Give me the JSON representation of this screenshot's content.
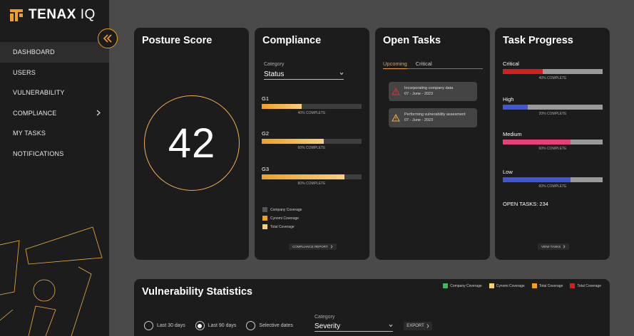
{
  "brand": {
    "name": "TENAX",
    "suffix": "IQ",
    "accent": "#f0a020"
  },
  "sidebar": {
    "items": [
      {
        "label": "DASHBOARD",
        "active": true
      },
      {
        "label": "USERS"
      },
      {
        "label": "VULNERABILITY"
      },
      {
        "label": "COMPLIANCE",
        "has_chevron": true
      },
      {
        "label": "MY TASKS"
      },
      {
        "label": "NOTIFICATIONS"
      }
    ]
  },
  "posture": {
    "title": "Posture Score",
    "score": "42"
  },
  "compliance": {
    "title": "Compliance",
    "category_label": "Category",
    "category_value": "Status",
    "groups": [
      {
        "name": "G1",
        "caption": "40% COMPLETE",
        "fraction": 0.4
      },
      {
        "name": "G2",
        "caption": "60% COMPLETE",
        "fraction": 0.62
      },
      {
        "name": "G3",
        "caption": "80% COMPLETE",
        "fraction": 0.83
      }
    ],
    "legend": [
      {
        "label": "Company Coverage",
        "color": "#555555"
      },
      {
        "label": "Cynomi Coverage",
        "color": "#f0a020"
      },
      {
        "label": "Total Coverage",
        "color": "#f5cf80"
      }
    ],
    "report_button": "COMPLIANCE REPORT"
  },
  "open_tasks": {
    "title": "Open Tasks",
    "tabs": [
      "Upcoming",
      "Critical"
    ],
    "items": [
      {
        "title": "Incorporating  company data",
        "date": "07 - June - 2023",
        "icon": "alert-triangle-red"
      },
      {
        "title": "Performing vulnerability assesment",
        "date": "07 - June - 2023",
        "icon": "alert-triangle-amber"
      }
    ]
  },
  "task_progress": {
    "title": "Task Progress",
    "groups": [
      {
        "name": "Critical",
        "caption": "40% COMPLETE",
        "fraction": 0.4,
        "color": "#d41f1f"
      },
      {
        "name": "High",
        "caption": "20% COMPLETE",
        "fraction": 0.25,
        "color": "#3f56d6"
      },
      {
        "name": "Medium",
        "caption": "60% COMPLETE",
        "fraction": 0.68,
        "color": "#e8407a"
      },
      {
        "name": "Low",
        "caption": "60% COMPLETE",
        "fraction": 0.68,
        "color": "#3f56d6"
      }
    ],
    "open_tasks_text": "OPEN TASKS: 234",
    "view_button": "VIEW TASKS"
  },
  "vulnerability": {
    "title": "Vulnerability Statistics",
    "legend": [
      {
        "label": "Company Coverage",
        "color": "#3cba54"
      },
      {
        "label": "Cynomi Coverage",
        "color": "#f5cf80"
      },
      {
        "label": "Total Coverage",
        "color": "#f0a020"
      },
      {
        "label": "Total Coverage",
        "color": "#d41f1f"
      }
    ],
    "ranges": [
      {
        "label": "Last 30 days",
        "selected": false
      },
      {
        "label": "Last 90 days",
        "selected": true
      },
      {
        "label": "Selective dates",
        "selected": false
      }
    ],
    "category_label": "Category",
    "category_value": "Severity",
    "export_button": "EXPORT"
  }
}
